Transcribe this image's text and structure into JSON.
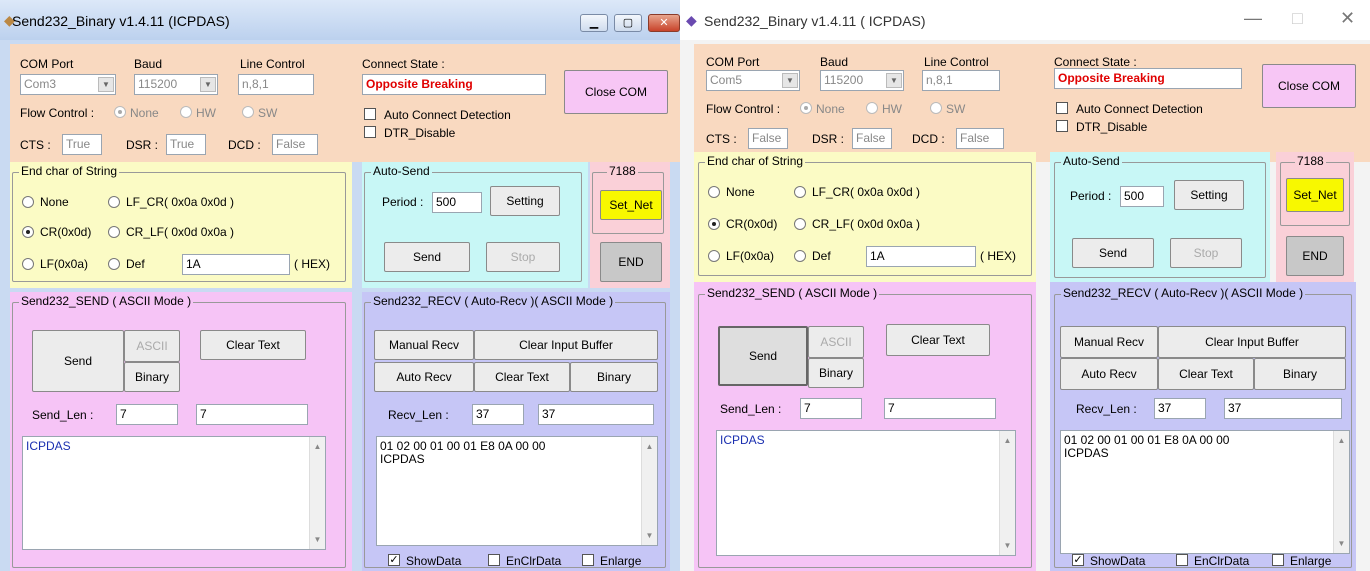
{
  "left": {
    "title": "Send232_Binary  v1.4.11  (ICPDAS)",
    "caption": {
      "minimize": "▁",
      "maximize": "▢",
      "close": "✕"
    },
    "com": {
      "port_label": "COM Port",
      "port_value": "Com3",
      "baud_label": "Baud",
      "baud_value": "115200",
      "line_label": "Line Control",
      "line_value": "n,8,1",
      "flow_label": "Flow Control :",
      "flow_none": "None",
      "flow_hw": "HW",
      "flow_sw": "SW",
      "cts_label": "CTS :",
      "cts_value": "True",
      "dsr_label": "DSR :",
      "dsr_value": "True",
      "dcd_label": "DCD :",
      "dcd_value": "False",
      "state_label": "Connect State :",
      "state_value": "Opposite Breaking",
      "close_btn": "Close COM",
      "auto_detect": "Auto Connect Detection",
      "dtr_disable": "DTR_Disable"
    },
    "endchar": {
      "legend": "End char of String",
      "none": "None",
      "lfcr": "LF_CR( 0x0a 0x0d )",
      "cr": "CR(0x0d)",
      "crlf": "CR_LF( 0x0d 0x0a )",
      "lf": "LF(0x0a)",
      "def": "Def",
      "def_value": "1A",
      "hex": "( HEX)"
    },
    "autosend": {
      "legend": "Auto-Send",
      "period_label": "Period :",
      "period_value": "500",
      "setting": "Setting",
      "send": "Send",
      "stop": "Stop"
    },
    "net": {
      "legend": "7188",
      "set_net": "Set_Net",
      "end": "END"
    },
    "sendpanel": {
      "legend": "Send232_SEND ( ASCII Mode )",
      "send": "Send",
      "ascii": "ASCII",
      "binary": "Binary",
      "clear": "Clear Text",
      "len_label": "Send_Len :",
      "len1": "7",
      "len2": "7",
      "text": "ICPDAS"
    },
    "recvpanel": {
      "legend": "Send232_RECV ( Auto-Recv )( ASCII Mode )",
      "manual": "Manual Recv",
      "clear_input": "Clear Input Buffer",
      "auto": "Auto Recv",
      "clear_text": "Clear Text",
      "binary": "Binary",
      "len_label": "Recv_Len :",
      "len1": "37",
      "len2": "37",
      "text": "01 02 00 01 00 01 E8 0A 00 00\nICPDAS",
      "showdata": "ShowData",
      "enclr": "EnClrData",
      "enlarge": "Enlarge"
    }
  },
  "right": {
    "title": "Send232_Binary  v1.4.11  ( ICPDAS)",
    "caption": {
      "minimize": "—",
      "maximize": "□",
      "close": "✕"
    },
    "com": {
      "port_label": "COM Port",
      "port_value": "Com5",
      "baud_label": "Baud",
      "baud_value": "115200",
      "line_label": "Line Control",
      "line_value": "n,8,1",
      "flow_label": "Flow Control :",
      "flow_none": "None",
      "flow_hw": "HW",
      "flow_sw": "SW",
      "cts_label": "CTS :",
      "cts_value": "False",
      "dsr_label": "DSR :",
      "dsr_value": "False",
      "dcd_label": "DCD :",
      "dcd_value": "False",
      "state_label": "Connect State :",
      "state_value": "Opposite Breaking",
      "close_btn": "Close COM",
      "auto_detect": "Auto Connect Detection",
      "dtr_disable": "DTR_Disable"
    },
    "endchar": {
      "legend": "End char of String",
      "none": "None",
      "lfcr": "LF_CR( 0x0a 0x0d )",
      "cr": "CR(0x0d)",
      "crlf": "CR_LF( 0x0d 0x0a )",
      "lf": "LF(0x0a)",
      "def": "Def",
      "def_value": "1A",
      "hex": "( HEX)"
    },
    "autosend": {
      "legend": "Auto-Send",
      "period_label": "Period :",
      "period_value": "500",
      "setting": "Setting",
      "send": "Send",
      "stop": "Stop"
    },
    "net": {
      "legend": "7188",
      "set_net": "Set_Net",
      "end": "END"
    },
    "sendpanel": {
      "legend": "Send232_SEND ( ASCII Mode )",
      "send": "Send",
      "ascii": "ASCII",
      "binary": "Binary",
      "clear": "Clear Text",
      "len_label": "Send_Len :",
      "len1": "7",
      "len2": "7",
      "text": "ICPDAS"
    },
    "recvpanel": {
      "legend": "Send232_RECV ( Auto-Recv )( ASCII Mode )",
      "manual": "Manual Recv",
      "clear_input": "Clear Input Buffer",
      "auto": "Auto Recv",
      "clear_text": "Clear Text",
      "binary": "Binary",
      "len_label": "Recv_Len :",
      "len1": "37",
      "len2": "37",
      "text": "01 02 00 01 00 01 E8 0A 00 00\nICPDAS",
      "showdata": "ShowData",
      "enclr": "EnClrData",
      "enlarge": "Enlarge"
    }
  }
}
